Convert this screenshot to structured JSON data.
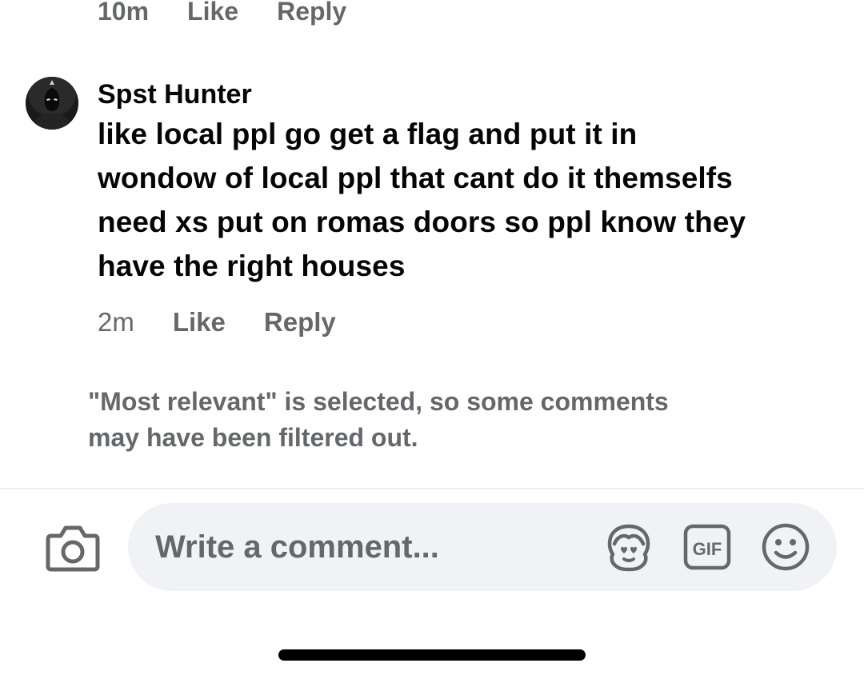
{
  "previous_comment": {
    "time": "10m",
    "like_label": "Like",
    "reply_label": "Reply"
  },
  "comment": {
    "author": "Spst Hunter",
    "avatar_icon": "hooded-figure-avatar",
    "lines": [
      "like local ppl go get a flag and put it in",
      "wondow of local ppl that cant do it themselfs",
      "need xs put on romas doors so ppl know they",
      "have the right houses"
    ],
    "time": "2m",
    "like_label": "Like",
    "reply_label": "Reply"
  },
  "notice": {
    "line1": "\"Most relevant\" is selected, so some comments",
    "line2": "may have been filtered out."
  },
  "composer": {
    "placeholder": "Write a comment...",
    "camera_icon": "camera-icon",
    "avatar_sticker_icon": "avatar-sticker-icon",
    "gif_icon": "gif-icon",
    "gif_label": "GIF",
    "emoji_icon": "emoji-icon"
  },
  "colors": {
    "text_primary": "#050505",
    "text_secondary": "#65676b",
    "input_background": "#f0f2f5",
    "home_indicator": "#000000"
  }
}
